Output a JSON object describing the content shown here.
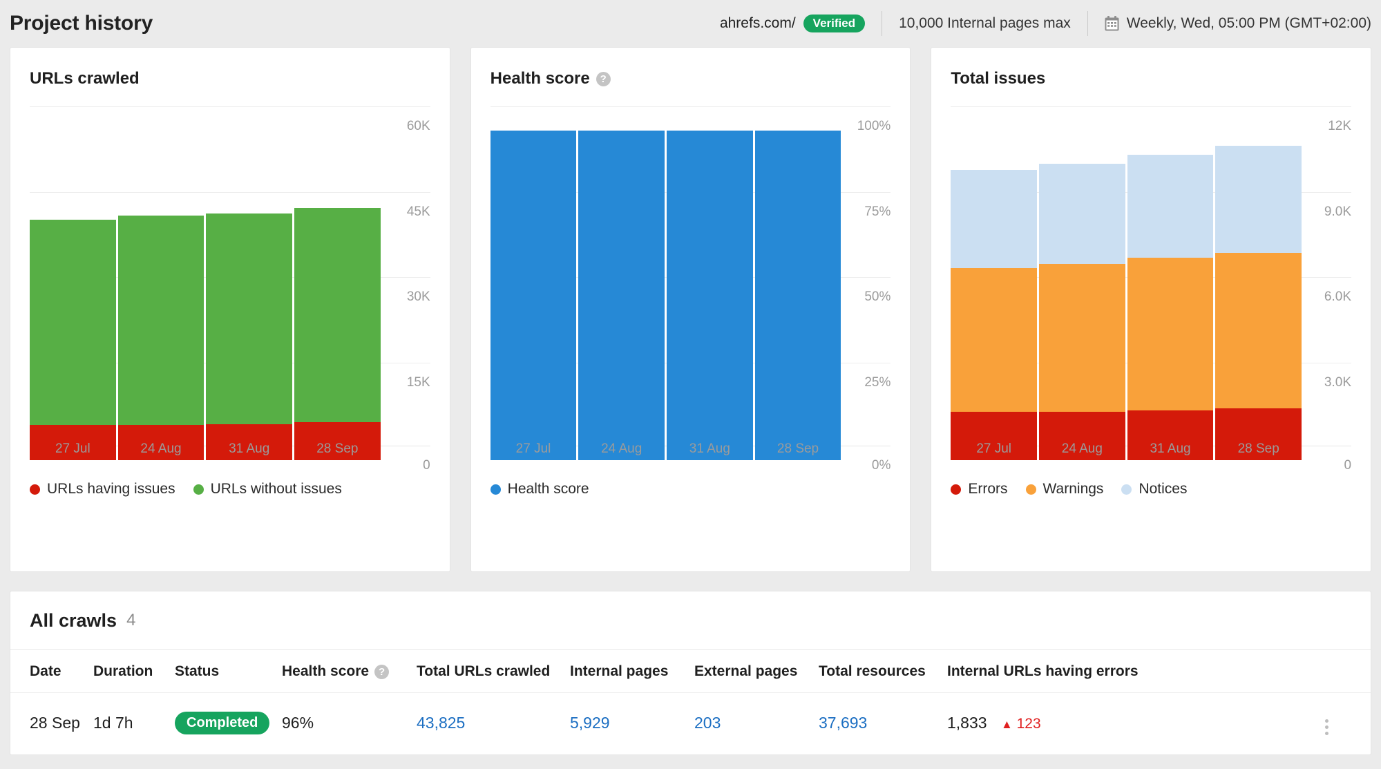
{
  "header": {
    "title": "Project history",
    "domain": "ahrefs.com/",
    "verified_label": "Verified",
    "pages_max": "10,000 Internal pages max",
    "calendar_icon": "calendar-icon",
    "schedule": "Weekly, Wed, 05:00 PM (GMT+02:00)"
  },
  "colors": {
    "green": "#57af45",
    "red": "#d41a0a",
    "blue": "#2689d6",
    "orange": "#f9a13a",
    "light_blue": "#cbdff2",
    "link": "#1b6ec2",
    "badge_green": "#16a45e",
    "error_red": "#e02020"
  },
  "cards": [
    {
      "title": "URLs crawled",
      "has_help": false,
      "yticks": [
        "60K",
        "45K",
        "30K",
        "15K",
        "0"
      ],
      "xticks": [
        "27 Jul",
        "24 Aug",
        "31 Aug",
        "28 Sep"
      ],
      "legend": [
        {
          "label": "URLs having issues",
          "color": "#d41a0a"
        },
        {
          "label": "URLs without issues",
          "color": "#57af45"
        }
      ]
    },
    {
      "title": "Health score",
      "has_help": true,
      "help_icon": "help-icon",
      "yticks": [
        "100%",
        "75%",
        "50%",
        "25%",
        "0%"
      ],
      "xticks": [
        "27 Jul",
        "24 Aug",
        "31 Aug",
        "28 Sep"
      ],
      "legend": [
        {
          "label": "Health score",
          "color": "#2689d6"
        }
      ]
    },
    {
      "title": "Total issues",
      "has_help": false,
      "yticks": [
        "12K",
        "9.0K",
        "6.0K",
        "3.0K",
        "0"
      ],
      "xticks": [
        "27 Jul",
        "24 Aug",
        "31 Aug",
        "28 Sep"
      ],
      "legend": [
        {
          "label": "Errors",
          "color": "#d41a0a"
        },
        {
          "label": "Warnings",
          "color": "#f9a13a"
        },
        {
          "label": "Notices",
          "color": "#cbdff2"
        }
      ]
    }
  ],
  "chart_data": [
    {
      "type": "bar",
      "title": "URLs crawled",
      "stacked": true,
      "categories": [
        "27 Jul",
        "24 Aug",
        "31 Aug",
        "28 Sep"
      ],
      "series": [
        {
          "name": "URLs having issues",
          "color": "#d41a0a",
          "values": [
            6200,
            6200,
            6300,
            6700
          ]
        },
        {
          "name": "URLs without issues",
          "color": "#57af45",
          "values": [
            36300,
            37000,
            37300,
            37800
          ]
        }
      ],
      "ylabel": "",
      "xlabel": "",
      "ylim": [
        0,
        60000
      ],
      "yticks": [
        0,
        15000,
        30000,
        45000,
        60000
      ],
      "ytick_labels": [
        "0",
        "15K",
        "30K",
        "45K",
        "60K"
      ],
      "grid": true,
      "legend_position": "bottom-left"
    },
    {
      "type": "bar",
      "title": "Health score",
      "stacked": false,
      "categories": [
        "27 Jul",
        "24 Aug",
        "31 Aug",
        "28 Sep"
      ],
      "series": [
        {
          "name": "Health score",
          "color": "#2689d6",
          "values": [
            97,
            97,
            97,
            97
          ]
        }
      ],
      "ylabel": "",
      "xlabel": "",
      "ylim": [
        0,
        100
      ],
      "yticks": [
        0,
        25,
        50,
        75,
        100
      ],
      "ytick_labels": [
        "0%",
        "25%",
        "50%",
        "75%",
        "100%"
      ],
      "grid": true,
      "legend_position": "bottom-left"
    },
    {
      "type": "bar",
      "title": "Total issues",
      "stacked": true,
      "categories": [
        "27 Jul",
        "24 Aug",
        "31 Aug",
        "28 Sep"
      ],
      "series": [
        {
          "name": "Errors",
          "color": "#d41a0a",
          "values": [
            1700,
            1700,
            1750,
            1830
          ]
        },
        {
          "name": "Warnings",
          "color": "#f9a13a",
          "values": [
            5100,
            5250,
            5400,
            5500
          ]
        },
        {
          "name": "Notices",
          "color": "#cbdff2",
          "values": [
            3500,
            3550,
            3650,
            3800
          ]
        }
      ],
      "ylabel": "",
      "xlabel": "",
      "ylim": [
        0,
        12000
      ],
      "yticks": [
        0,
        3000,
        6000,
        9000,
        12000
      ],
      "ytick_labels": [
        "0",
        "3.0K",
        "6.0K",
        "9.0K",
        "12K"
      ],
      "grid": true,
      "legend_position": "bottom-left"
    }
  ],
  "crawls": {
    "title": "All crawls",
    "count": "4",
    "columns": [
      {
        "label": "Date",
        "help": false
      },
      {
        "label": "Duration",
        "help": false
      },
      {
        "label": "Status",
        "help": false
      },
      {
        "label": "Health score",
        "help": true
      },
      {
        "label": "Total URLs crawled",
        "help": false
      },
      {
        "label": "Internal pages",
        "help": false
      },
      {
        "label": "External pages",
        "help": false
      },
      {
        "label": "Total resources",
        "help": false
      },
      {
        "label": "Internal URLs having errors",
        "help": false
      }
    ],
    "rows": [
      {
        "date": "28 Sep",
        "duration": "1d 7h",
        "status": "Completed",
        "health_score": "96%",
        "total_urls_crawled": "43,825",
        "internal_pages": "5,929",
        "external_pages": "203",
        "total_resources": "37,693",
        "internal_urls_having_errors": "1,833",
        "errors_delta": "123",
        "errors_delta_direction": "up",
        "menu_icon": "kebab-menu-icon"
      }
    ]
  }
}
